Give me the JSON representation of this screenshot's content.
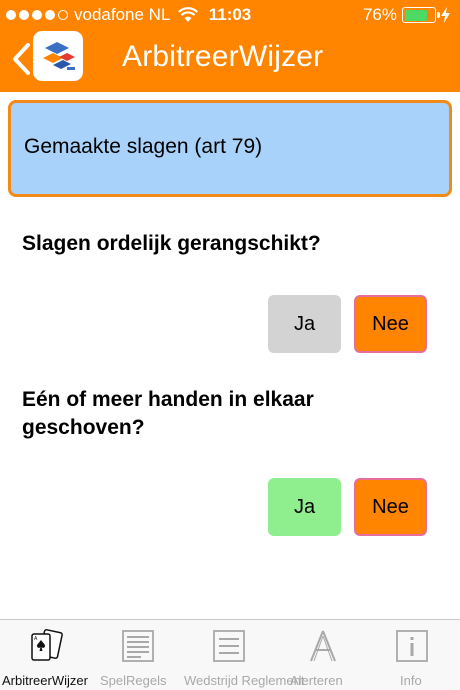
{
  "status_bar": {
    "carrier": "vodafone NL",
    "time": "11:03",
    "battery": "76%",
    "battery_level": 0.76,
    "signal_bars": 4
  },
  "nav": {
    "title": "ArbitreerWijzer"
  },
  "topic": {
    "label": "Gemaakte slagen (art 79)"
  },
  "questions": [
    {
      "text": "Slagen ordelijk gerangschikt?",
      "yes_label": "Ja",
      "no_label": "Nee",
      "yes_color": "#d3d3d3",
      "no_color": "#ff8400"
    },
    {
      "text": "Eén of meer handen in elkaar geschoven?",
      "yes_label": "Ja",
      "no_label": "Nee",
      "yes_color": "#8fef8f",
      "no_color": "#ff8400"
    }
  ],
  "tabs": [
    {
      "label": "ArbitreerWijzer",
      "icon": "cards-icon",
      "active": true
    },
    {
      "label": "SpelRegels",
      "icon": "document-list-icon",
      "active": false
    },
    {
      "label": "Wedstrijd Reglement",
      "icon": "lines-list-icon",
      "active": false
    },
    {
      "label": "Alerteren",
      "icon": "letter-a-icon",
      "active": false
    },
    {
      "label": "Info",
      "icon": "info-icon",
      "active": false
    }
  ],
  "colors": {
    "brand": "#ff8400",
    "topic_bg": "#a9d2fa",
    "topic_border": "#f28a17"
  }
}
